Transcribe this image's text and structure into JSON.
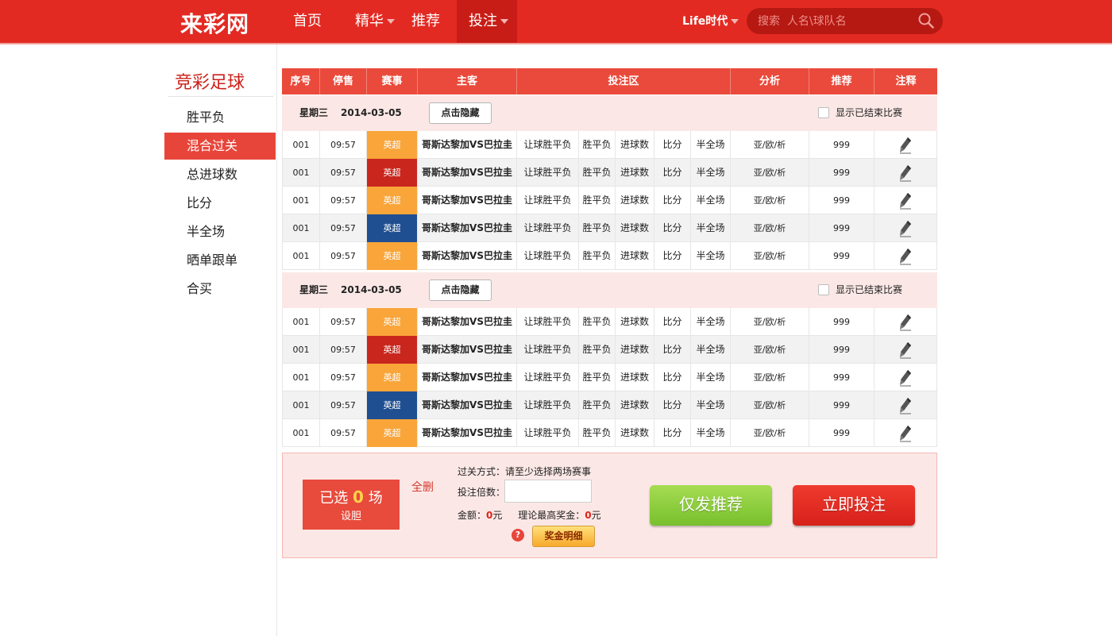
{
  "header": {
    "logo": "来彩网",
    "nav": [
      {
        "label": "首页",
        "has_caret": false
      },
      {
        "label": "精华",
        "has_caret": true
      },
      {
        "label": "推荐",
        "has_caret": false
      },
      {
        "label": "投注",
        "has_caret": true,
        "active": true
      }
    ],
    "life_label": "Life时代",
    "search_placeholder": "搜索  人名\\球队名",
    "colors": {
      "bar": "#e32a22",
      "active": "#c81d17",
      "search": "#b51912"
    }
  },
  "sidebar": {
    "title": "竞彩足球",
    "items": [
      {
        "label": "胜平负",
        "active": false
      },
      {
        "label": "混合过关",
        "active": true
      },
      {
        "label": "总进球数",
        "active": false
      },
      {
        "label": "比分",
        "active": false
      },
      {
        "label": "半全场",
        "active": false
      },
      {
        "label": "晒单跟单",
        "active": false
      },
      {
        "label": "合买",
        "active": false
      }
    ]
  },
  "table": {
    "headers": [
      "序号",
      "停售",
      "赛事",
      "主客",
      "投注区",
      "分析",
      "推荐",
      "注释"
    ],
    "groups": [
      {
        "weekday": "星期三",
        "date": "2014-03-05",
        "hide_button": "点击隐藏",
        "show_ended_label": "显示已结束比赛",
        "rows": [
          {
            "no": "001",
            "time": "09:57",
            "league": "英超",
            "league_color": "#f9a53a",
            "match": "哥斯达黎加VS巴拉圭",
            "bets": [
              "让球胜平负",
              "胜平负",
              "进球数",
              "比分",
              "半全场"
            ],
            "analysis": "亚/欧/析",
            "recommend": "999"
          },
          {
            "no": "001",
            "time": "09:57",
            "league": "英超",
            "league_color": "#c9261d",
            "match": "哥斯达黎加VS巴拉圭",
            "bets": [
              "让球胜平负",
              "胜平负",
              "进球数",
              "比分",
              "半全场"
            ],
            "analysis": "亚/欧/析",
            "recommend": "999"
          },
          {
            "no": "001",
            "time": "09:57",
            "league": "英超",
            "league_color": "#f9a53a",
            "match": "哥斯达黎加VS巴拉圭",
            "bets": [
              "让球胜平负",
              "胜平负",
              "进球数",
              "比分",
              "半全场"
            ],
            "analysis": "亚/欧/析",
            "recommend": "999"
          },
          {
            "no": "001",
            "time": "09:57",
            "league": "英超",
            "league_color": "#1f4f91",
            "match": "哥斯达黎加VS巴拉圭",
            "bets": [
              "让球胜平负",
              "胜平负",
              "进球数",
              "比分",
              "半全场"
            ],
            "analysis": "亚/欧/析",
            "recommend": "999"
          },
          {
            "no": "001",
            "time": "09:57",
            "league": "英超",
            "league_color": "#f9a53a",
            "match": "哥斯达黎加VS巴拉圭",
            "bets": [
              "让球胜平负",
              "胜平负",
              "进球数",
              "比分",
              "半全场"
            ],
            "analysis": "亚/欧/析",
            "recommend": "999"
          }
        ]
      },
      {
        "weekday": "星期三",
        "date": "2014-03-05",
        "hide_button": "点击隐藏",
        "show_ended_label": "显示已结束比赛",
        "rows": [
          {
            "no": "001",
            "time": "09:57",
            "league": "英超",
            "league_color": "#f9a53a",
            "match": "哥斯达黎加VS巴拉圭",
            "bets": [
              "让球胜平负",
              "胜平负",
              "进球数",
              "比分",
              "半全场"
            ],
            "analysis": "亚/欧/析",
            "recommend": "999"
          },
          {
            "no": "001",
            "time": "09:57",
            "league": "英超",
            "league_color": "#c9261d",
            "match": "哥斯达黎加VS巴拉圭",
            "bets": [
              "让球胜平负",
              "胜平负",
              "进球数",
              "比分",
              "半全场"
            ],
            "analysis": "亚/欧/析",
            "recommend": "999"
          },
          {
            "no": "001",
            "time": "09:57",
            "league": "英超",
            "league_color": "#f9a53a",
            "match": "哥斯达黎加VS巴拉圭",
            "bets": [
              "让球胜平负",
              "胜平负",
              "进球数",
              "比分",
              "半全场"
            ],
            "analysis": "亚/欧/析",
            "recommend": "999"
          },
          {
            "no": "001",
            "time": "09:57",
            "league": "英超",
            "league_color": "#1f4f91",
            "match": "哥斯达黎加VS巴拉圭",
            "bets": [
              "让球胜平负",
              "胜平负",
              "进球数",
              "比分",
              "半全场"
            ],
            "analysis": "亚/欧/析",
            "recommend": "999"
          },
          {
            "no": "001",
            "time": "09:57",
            "league": "英超",
            "league_color": "#f9a53a",
            "match": "哥斯达黎加VS巴拉圭",
            "bets": [
              "让球胜平负",
              "胜平负",
              "进球数",
              "比分",
              "半全场"
            ],
            "analysis": "亚/欧/析",
            "recommend": "999"
          }
        ]
      }
    ]
  },
  "betslip": {
    "selected_prefix": "已选",
    "selected_count": "0",
    "selected_suffix": "场",
    "set_banker": "设胆",
    "delete_all": "全删",
    "pass_mode_label": "过关方式：",
    "pass_mode_value": "请至少选择两场赛事",
    "multiplier_label": "投注倍数：",
    "multiplier_value": "",
    "amount_label": "金额：",
    "amount_value": "0",
    "amount_unit": "元",
    "max_prize_label": "理论最高奖金：",
    "max_prize_value": "0",
    "max_prize_unit": "元",
    "help_icon": "?",
    "prize_detail_button": "奖金明细",
    "recommend_only_button": "仅发推荐",
    "bet_now_button": "立即投注"
  }
}
